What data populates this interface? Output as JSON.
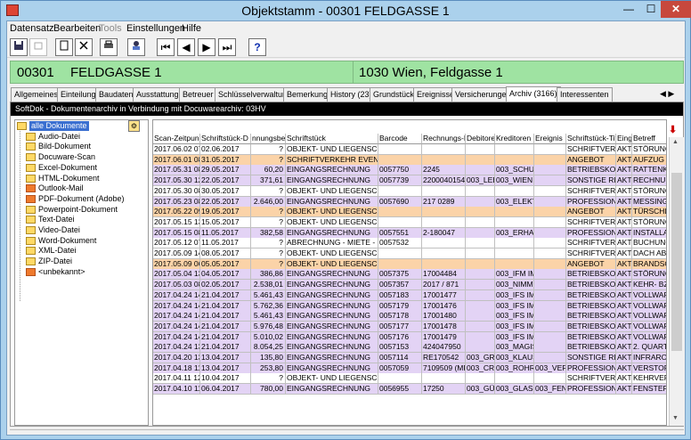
{
  "window": {
    "title": "Objektstamm - 00301 FELDGASSE 1",
    "min": "—",
    "max": "☐",
    "close": "✕"
  },
  "menu": [
    "Datensatz",
    "Bearbeiten",
    "Tools",
    "Einstellungen",
    "Hilfe"
  ],
  "toolbar": {
    "help": "?",
    "first": "⏮",
    "prev": "◀",
    "next": "▶",
    "last": "⏭",
    "new_icon": "new-document-icon",
    "close_icon": "delete-icon",
    "print_icon": "print-icon",
    "tool_icon": "user-settings-icon"
  },
  "header": {
    "number": "00301",
    "name": "FELDGASSE 1",
    "address": "1030 Wien, Feldgasse 1"
  },
  "tabs": [
    "Allgemeines",
    "Einteilung",
    "Baudaten",
    "Ausstattung",
    "Betreuer",
    "Schlüsselverwaltung",
    "Bemerkung",
    "History (23)",
    "Grundstück",
    "Ereignisse",
    "Versicherungen",
    "Archiv (3166)",
    "Interessenten"
  ],
  "tab_nav": "◀ ▶ ▼",
  "panel_title": "SoftDok - Dokumentenarchiv in Verbindung mit Docuwarearchiv: 03HV",
  "tree": [
    "alle Dokumente",
    "Audio-Datei",
    "Bild-Dokument",
    "Docuware-Scan",
    "Excel-Dokument",
    "HTML-Dokument",
    "Outlook-Mail",
    "PDF-Dokument (Adobe)",
    "Powerpoint-Dokument",
    "Text-Datei",
    "Video-Datei",
    "Word-Dokument",
    "XML-Datei",
    "ZIP-Datei",
    "<unbekannt>"
  ],
  "grid": {
    "columns": [
      "Scan-Zeitpunk",
      "Schriftstück-D",
      "nnungsbetrag",
      "Schriftstück",
      "Barcode",
      "Rechnungs-N",
      "Debitore",
      "Kreditoren",
      "Ereignis",
      "Schriftstück-Tite",
      "Eing",
      "Betreff"
    ],
    "rows": [
      [
        "2017.06.02 07",
        "02.06.2017",
        "?",
        "OBJEKT- UND LIEGENSCHA",
        "",
        "",
        "",
        "",
        "",
        "SCHRIFTVERKA",
        "AKT",
        "STÖRUNG A"
      ],
      [
        "2017.06.01 08",
        "31.05.2017",
        "?",
        "SCHRIFTVERKEHR EVENTS",
        "",
        "",
        "",
        "",
        "",
        "ANGEBOT",
        "AKT",
        "AUFZUG AN"
      ],
      [
        "2017.05.31 08",
        "29.05.2017",
        "60,20",
        "EINGANGSRECHNUNG",
        "0057750",
        "2245",
        "",
        "003_SCHUL",
        "",
        "BETRIEBSKOS",
        "AKT",
        "RATTENKÖ"
      ],
      [
        "2017.05.30 12",
        "22.05.2017",
        "371,61",
        "EINGANGSRECHNUNG",
        "0057739",
        "22000401542",
        "003_LEE",
        "003_WIEN I",
        "",
        "SONSTIGE RE",
        "AKT",
        "RECHNUNG"
      ],
      [
        "2017.05.30 08",
        "30.05.2017",
        "?",
        "OBJEKT- UND LIEGENSCHA",
        "",
        "",
        "",
        "",
        "",
        "SCHRIFTVERKA",
        "AKT",
        "STÖRUNGS"
      ],
      [
        "2017.05.23 08",
        "22.05.2017",
        "2.646,00",
        "EINGANGSRECHNUNG",
        "0057690",
        "217 0289",
        "",
        "003_ELEKT",
        "",
        "PROFESSIONI",
        "AKT",
        "MESSING TI"
      ],
      [
        "2017.05.22 09",
        "19.05.2017",
        "?",
        "OBJEKT- UND LIEGENSCHA",
        "",
        "",
        "",
        "",
        "",
        "ANGEBOT",
        "AKT",
        "TÜRSCHLIE"
      ],
      [
        "2017.05.15 13",
        "15.05.2017",
        "?",
        "OBJEKT- UND LIEGENSCHA",
        "",
        "",
        "",
        "",
        "",
        "SCHRIFTVERKA",
        "AKT",
        "STÖRUNGS"
      ],
      [
        "2017.05.15 08",
        "11.05.2017",
        "382,58",
        "EINGANGSRECHNUNG",
        "0057551",
        "2-180047",
        "",
        "003_ERHAF",
        "",
        "PROFESSIONI",
        "AKT",
        "INSTALLATE"
      ],
      [
        "2017.05.12 07",
        "11.05.2017",
        "?",
        "ABRECHNUNG - MIETE - BA",
        "0057532",
        "",
        "",
        "",
        "",
        "SCHRIFTVERKA",
        "AKT",
        "BUCHUNGS"
      ],
      [
        "2017.05.09 14",
        "08.05.2017",
        "?",
        "OBJEKT- UND LIEGENSCHA",
        "",
        "",
        "",
        "",
        "",
        "SCHRIFTVERKA",
        "AKT",
        "DACH ABST"
      ],
      [
        "2017.05.09 06",
        "05.05.2017",
        "?",
        "OBJEKT- UND LIEGENSCHA",
        "",
        "",
        "",
        "",
        "",
        "ANGEBOT",
        "AKT",
        "BRANDSCH"
      ],
      [
        "2017.05.04 13",
        "04.05.2017",
        "386,86",
        "EINGANGSRECHNUNG",
        "0057375",
        "17004484",
        "",
        "003_IFM IM",
        "",
        "BETRIEBSKOS",
        "AKT",
        "STÖRUNG"
      ],
      [
        "2017.05.03 08",
        "02.05.2017",
        "2.538,01",
        "EINGANGSRECHNUNG",
        "0057357",
        "2017 / 871",
        "",
        "003_NIMME",
        "",
        "BETRIEBSKOS",
        "AKT",
        "KEHR- BZW"
      ],
      [
        "2017.04.24 14",
        "21.04.2017",
        "5.461,43",
        "EINGANGSRECHNUNG",
        "0057183",
        "17001477",
        "",
        "003_IFS IM",
        "",
        "BETRIEBSKOS",
        "AKT",
        "VOLLWART"
      ],
      [
        "2017.04.24 14",
        "21.04.2017",
        "5.762,36",
        "EINGANGSRECHNUNG",
        "0057179",
        "17001476",
        "",
        "003_IFS IM",
        "",
        "BETRIEBSKOS",
        "AKT",
        "VOLLWART"
      ],
      [
        "2017.04.24 14",
        "21.04.2017",
        "5.461,43",
        "EINGANGSRECHNUNG",
        "0057178",
        "17001480",
        "",
        "003_IFS IM",
        "",
        "BETRIEBSKOS",
        "AKT",
        "VOLLWART"
      ],
      [
        "2017.04.24 14",
        "21.04.2017",
        "5.976,48",
        "EINGANGSRECHNUNG",
        "0057177",
        "17001478",
        "",
        "003_IFS IM",
        "",
        "BETRIEBSKOS",
        "AKT",
        "VOLLWART"
      ],
      [
        "2017.04.24 14",
        "21.04.2017",
        "5.010,02",
        "EINGANGSRECHNUNG",
        "0057176",
        "17001479",
        "",
        "003_IFS IM",
        "",
        "BETRIEBSKOS",
        "AKT",
        "VOLLWART"
      ],
      [
        "2017.04.24 13",
        "21.04.2017",
        "8.054,25",
        "EINGANGSRECHNUNG",
        "0057153",
        "424047950",
        "",
        "003_MAGIS",
        "",
        "BETRIEBSKOS",
        "AKT",
        "2. QUARTAL"
      ],
      [
        "2017.04.20 13",
        "13.04.2017",
        "135,80",
        "EINGANGSRECHNUNG",
        "0057114",
        "RE170542",
        "003_GRI",
        "003_KLAUS",
        "",
        "SONSTIGE RE",
        "AKT",
        "INFRAROT I"
      ],
      [
        "2017.04.18 11",
        "13.04.2017",
        "253,80",
        "EINGANGSRECHNUNG",
        "0057059",
        "7109509 (MF",
        "003_CR",
        "003_ROHR-",
        "003_VERS",
        "PROFESSIONI",
        "AKT",
        "VERSTOPFU"
      ],
      [
        "2017.04.11 12",
        "10.04.2017",
        "?",
        "OBJEKT- UND LIEGENSCHA",
        "",
        "",
        "",
        "",
        "",
        "SCHRIFTVERKA",
        "AKT",
        "KEHRVERH"
      ],
      [
        "2017.04.10 11",
        "06.04.2017",
        "780,00",
        "EINGANGSRECHNUNG",
        "0056955",
        "17250",
        "003_GÜ",
        "003_GLASE",
        "003_FEN",
        "PROFESSIONI",
        "AKT",
        "FENSTER A"
      ]
    ],
    "row_colors": [
      "#ffffff",
      "#fbd3a8",
      "#e3d3f5",
      "#e3d3f5",
      "#ffffff",
      "#e3d3f5",
      "#fbd3a8",
      "#ffffff",
      "#e3d3f5",
      "#ffffff",
      "#ffffff",
      "#fbd3a8",
      "#e3d3f5",
      "#e3d3f5",
      "#e3d3f5",
      "#e3d3f5",
      "#e3d3f5",
      "#e3d3f5",
      "#e3d3f5",
      "#e3d3f5",
      "#e3d3f5",
      "#e3d3f5",
      "#ffffff",
      "#e3d3f5"
    ]
  }
}
